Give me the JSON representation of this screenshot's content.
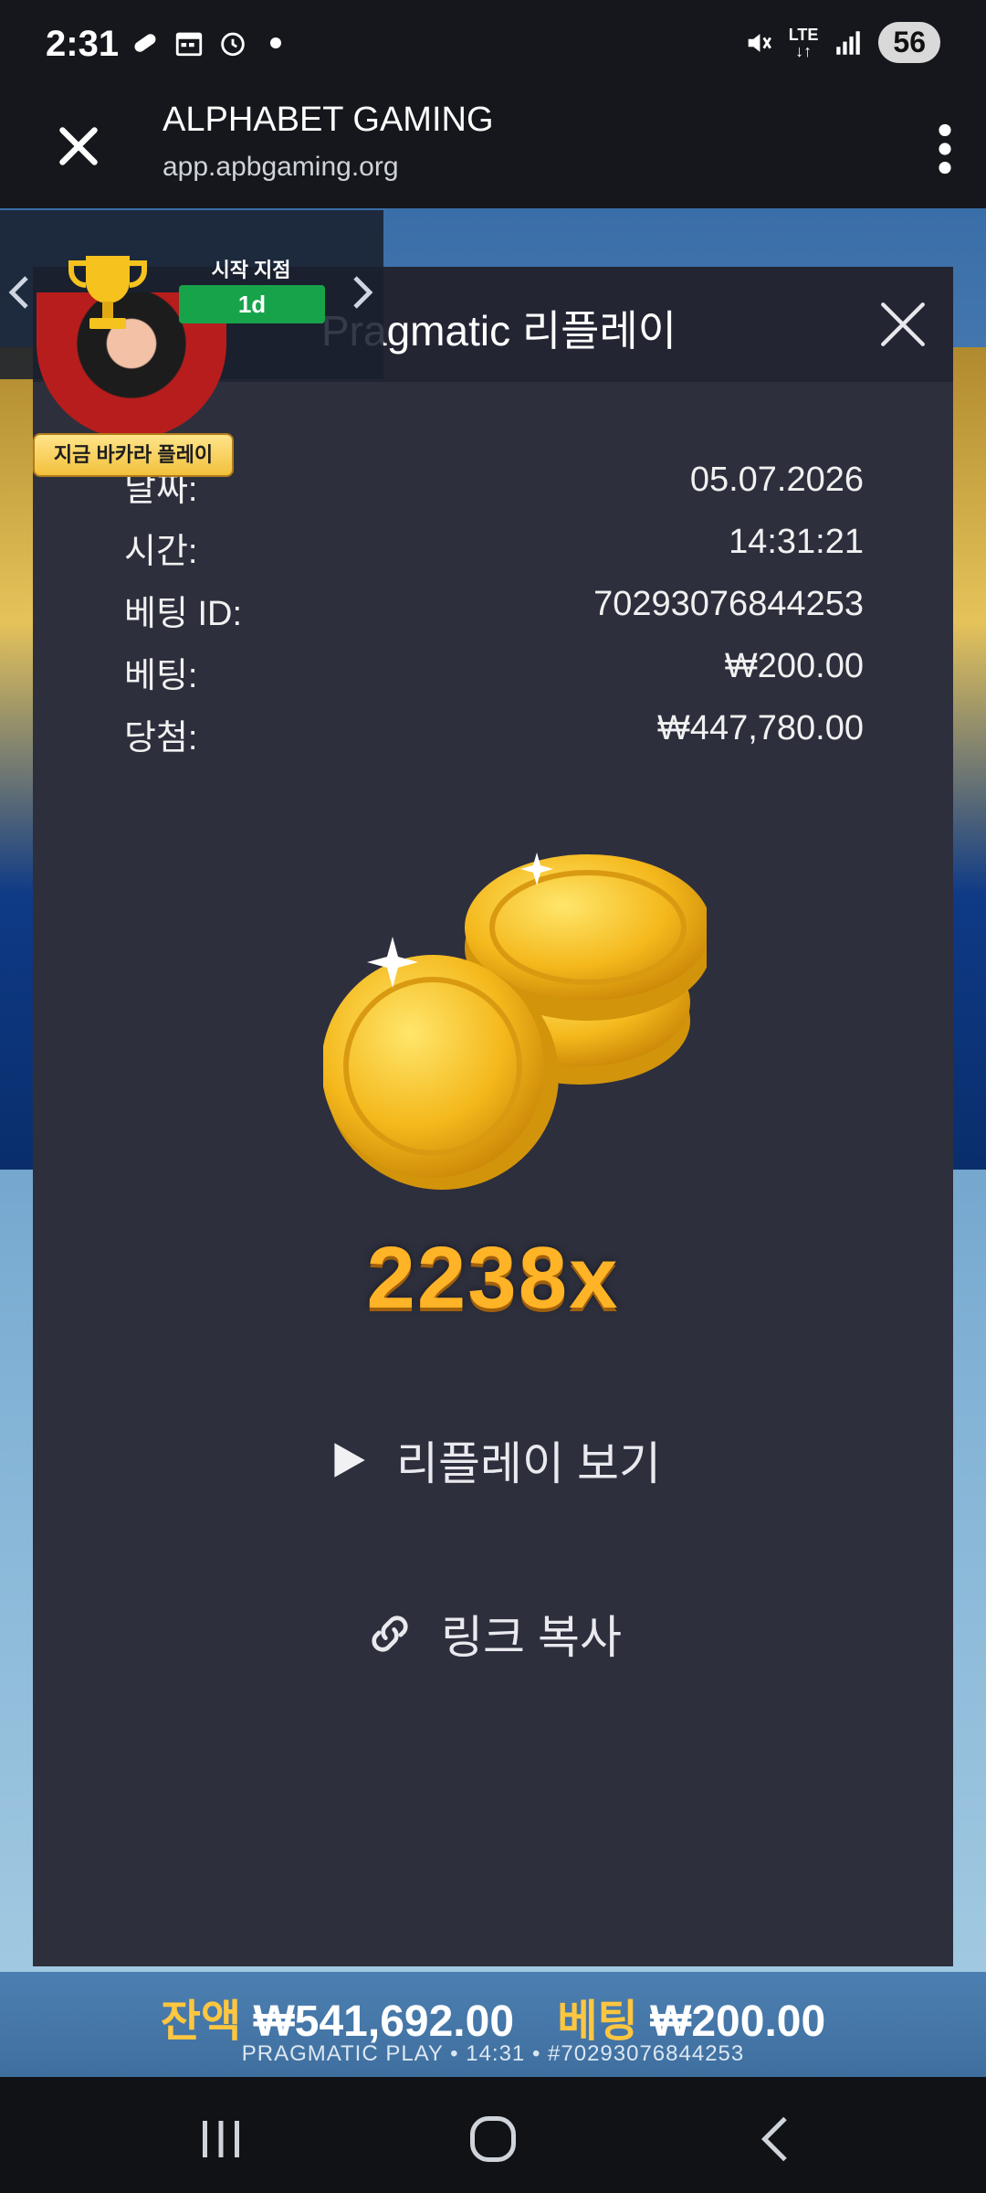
{
  "status_bar": {
    "time": "2:31",
    "left_icons": [
      "pill-icon",
      "calendar-icon",
      "alarm-icon",
      "dot-icon"
    ],
    "network": "LTE",
    "battery": "56"
  },
  "browser": {
    "title": "ALPHABET GAMING",
    "url": "app.apbgaming.org"
  },
  "promo": {
    "title": "시작 지점",
    "badge": "1d",
    "cta": "지금 바카라 플레이"
  },
  "modal": {
    "title": "Pragmatic 리플레이",
    "rows": [
      {
        "key": "날짜:",
        "value": "05.07.2026"
      },
      {
        "key": "시간:",
        "value": "14:31:21"
      },
      {
        "key": "베팅 ID:",
        "value": "70293076844253"
      },
      {
        "key": "베팅:",
        "value": "₩200.00"
      },
      {
        "key": "당첨:",
        "value": "₩447,780.00"
      }
    ],
    "multiplier": "2238x",
    "replay_label": "리플레이 보기",
    "copy_label": "링크 복사"
  },
  "game_footer": {
    "balance_label": "잔액",
    "balance_value": "₩541,692.00",
    "bet_label": "베팅",
    "bet_value": "₩200.00",
    "info": "PRAGMATIC PLAY • 14:31 • #70293076844253"
  },
  "colors": {
    "modal_bg": "#2d2f3d",
    "multiplier": "#ffb326",
    "badge_green": "#17a34a",
    "gold": "#ffc640"
  }
}
